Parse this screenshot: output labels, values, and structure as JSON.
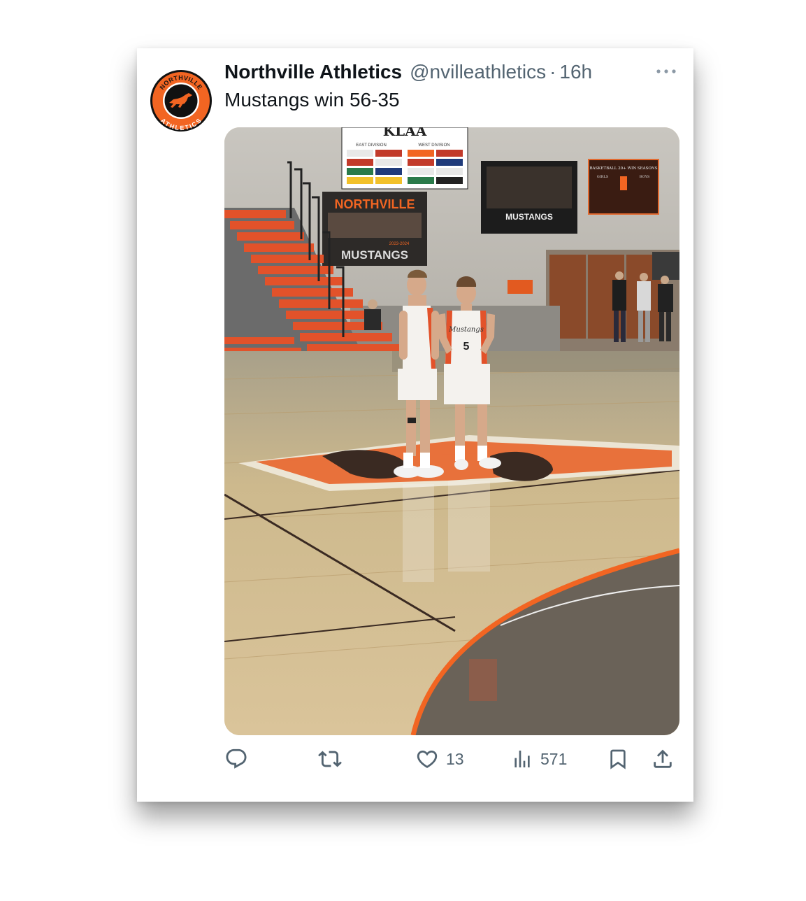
{
  "post": {
    "author_name": "Northville Athletics",
    "handle": "@nvilleathletics",
    "separator": "·",
    "timestamp": "16h",
    "text": "Mustangs win 56-35"
  },
  "avatar": {
    "top_text": "NORTHVILLE",
    "bottom_text": "ATHLETICS",
    "colors": {
      "ring": "#f26522",
      "inner": "#111111",
      "border": "#ffffff"
    }
  },
  "media": {
    "signs": {
      "kl": "KLAA",
      "east_division": "EAST DIVISION",
      "west_division": "WEST DIVISION",
      "banner_title": "NORTHVILLE",
      "banner_sub": "2023-2024",
      "banner_team": "MUSTANGS",
      "team_poster": "MUSTANGS",
      "seasons_board": "BASKETBALL 20+ WIN SEASONS",
      "seasons_girls": "GIRLS",
      "seasons_boys": "BOYS"
    },
    "jersey_number": "5",
    "jersey_text": "Mustangs"
  },
  "actions": {
    "reply_count": "",
    "retweet_count": "",
    "like_count": "13",
    "views_count": "571"
  },
  "icons": [
    "avatar-logo",
    "more-icon",
    "reply-icon",
    "retweet-icon",
    "like-icon",
    "views-icon",
    "bookmark-icon",
    "share-icon"
  ],
  "colors": {
    "text_primary": "#0f1419",
    "text_secondary": "#536471",
    "accent_orange": "#f26522"
  }
}
